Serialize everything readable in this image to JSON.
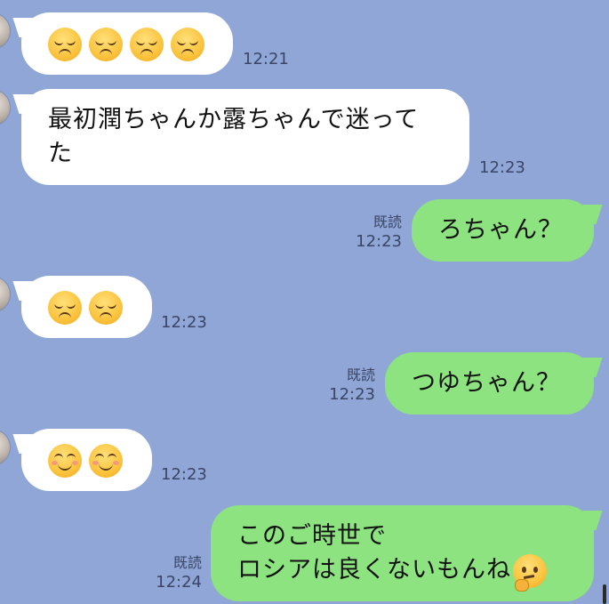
{
  "messages": [
    {
      "id": "m1",
      "direction": "in",
      "emoji": [
        "disappointed-face",
        "disappointed-face",
        "disappointed-face",
        "disappointed-face"
      ],
      "time": "12:21"
    },
    {
      "id": "m2",
      "direction": "in",
      "lines": [
        "最初潤ちゃんか露ちゃんで迷って",
        "た"
      ],
      "time": "12:23"
    },
    {
      "id": "m3",
      "direction": "out",
      "text": "ろちゃん？",
      "read": "既読",
      "time": "12:23"
    },
    {
      "id": "m4",
      "direction": "in",
      "emoji": [
        "disappointed-face",
        "disappointed-face"
      ],
      "time": "12:23"
    },
    {
      "id": "m5",
      "direction": "out",
      "text": "つゆちゃん？",
      "read": "既読",
      "time": "12:23"
    },
    {
      "id": "m6",
      "direction": "in",
      "emoji": [
        "smiling-face",
        "smiling-face"
      ],
      "time": "12:23"
    },
    {
      "id": "m7",
      "direction": "out",
      "lines": [
        "このご時世で",
        "ロシアは良くないもんね"
      ],
      "trailing_emoji": "thinking-face",
      "read": "既読",
      "time": "12:24"
    }
  ],
  "colors": {
    "background": "#8fa6d6",
    "incoming_bubble": "#ffffff",
    "outgoing_bubble": "#8de37f",
    "meta_text": "#3b4666"
  }
}
